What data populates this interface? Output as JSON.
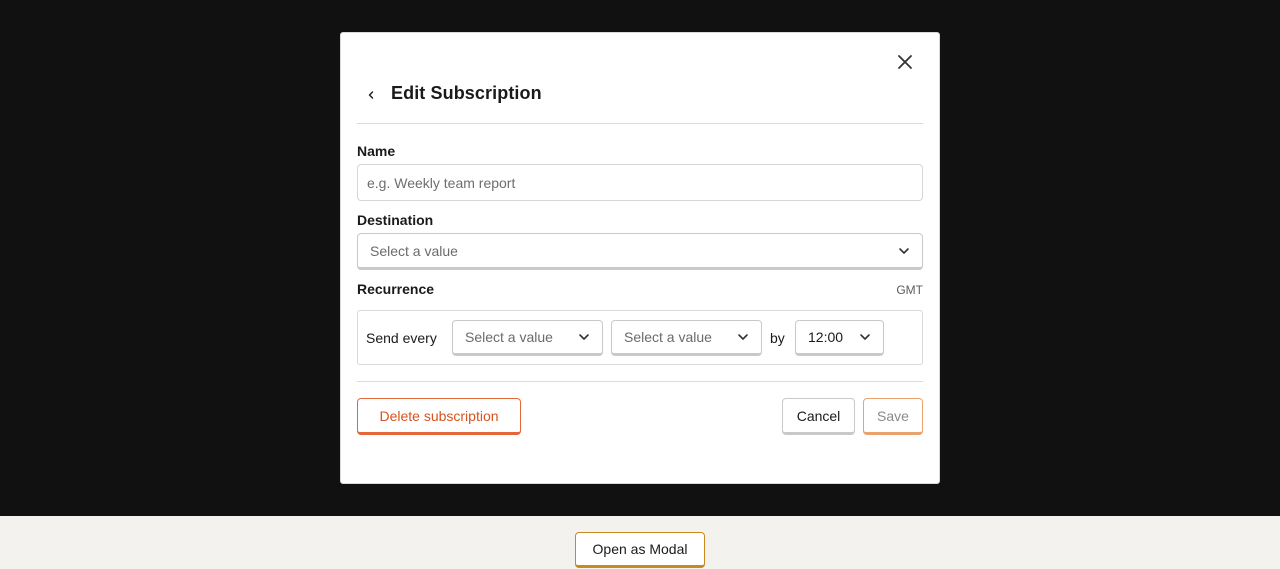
{
  "modal": {
    "title": "Edit Subscription",
    "close_icon": "close-icon",
    "back_icon": "chevron-left-icon"
  },
  "form": {
    "name": {
      "label": "Name",
      "value": "",
      "placeholder": "e.g. Weekly team report"
    },
    "destination": {
      "label": "Destination",
      "selected": "Select a value"
    },
    "recurrence": {
      "label": "Recurrence",
      "timezone": "GMT",
      "send_every_label": "Send every",
      "frequency_selected": "Select a value",
      "day_selected": "Select a value",
      "by_label": "by",
      "time_selected": "12:00"
    }
  },
  "actions": {
    "delete_label": "Delete subscription",
    "cancel_label": "Cancel",
    "save_label": "Save"
  },
  "page": {
    "open_modal_label": "Open as Modal"
  },
  "colors": {
    "overlay": "#111111",
    "danger": "#d9531e",
    "accent": "#c98a1e"
  }
}
